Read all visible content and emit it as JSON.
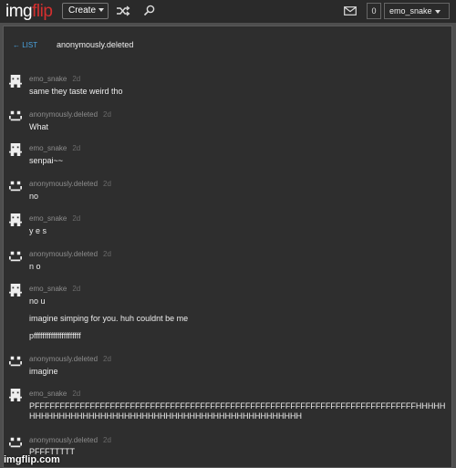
{
  "header": {
    "logo_img": "img",
    "logo_flip": "flip",
    "create_label": "Create",
    "notif_count": "0",
    "username": "emo_snake"
  },
  "conversation": {
    "back_label": "← LIST",
    "title": "anonymously.deleted"
  },
  "messages": [
    {
      "user": "emo_snake",
      "age": "2d",
      "avatar": "robot-icon",
      "lines": [
        "same they taste weird tho"
      ]
    },
    {
      "user": "anonymously.deleted",
      "age": "2d",
      "avatar": "smiley-icon",
      "lines": [
        "What"
      ]
    },
    {
      "user": "emo_snake",
      "age": "2d",
      "avatar": "robot-icon",
      "lines": [
        "senpai~~"
      ]
    },
    {
      "user": "anonymously.deleted",
      "age": "2d",
      "avatar": "smiley-icon",
      "lines": [
        "no"
      ]
    },
    {
      "user": "emo_snake",
      "age": "2d",
      "avatar": "robot-icon",
      "lines": [
        "y e s"
      ]
    },
    {
      "user": "anonymously.deleted",
      "age": "2d",
      "avatar": "smiley-icon",
      "lines": [
        "n o"
      ]
    },
    {
      "user": "emo_snake",
      "age": "2d",
      "avatar": "robot-icon",
      "lines": [
        "no u",
        "imagine simping for you. huh couldnt be me",
        "pffffffffffffffffffffff"
      ]
    },
    {
      "user": "anonymously.deleted",
      "age": "2d",
      "avatar": "smiley-icon",
      "lines": [
        "imagine"
      ]
    },
    {
      "user": "emo_snake",
      "age": "2d",
      "avatar": "robot-icon",
      "lines": [
        "PFFFFFFFFFFFFFFFFFFFFFFFFFFFFFFFFFFFFFFFFFFFFFFFFFFFFFFFFFFFFFFFFFFFFFFFFFFFFHHHHHHHHHHHHHHHHHHHHHHHHHHHHHHHHHHHHHHHHHHHHHHHHHHH"
      ]
    },
    {
      "user": "anonymously.deleted",
      "age": "2d",
      "avatar": "smiley-icon",
      "lines": [
        "PFFFTTTTT"
      ]
    }
  ],
  "watermark": "imgflip.com"
}
